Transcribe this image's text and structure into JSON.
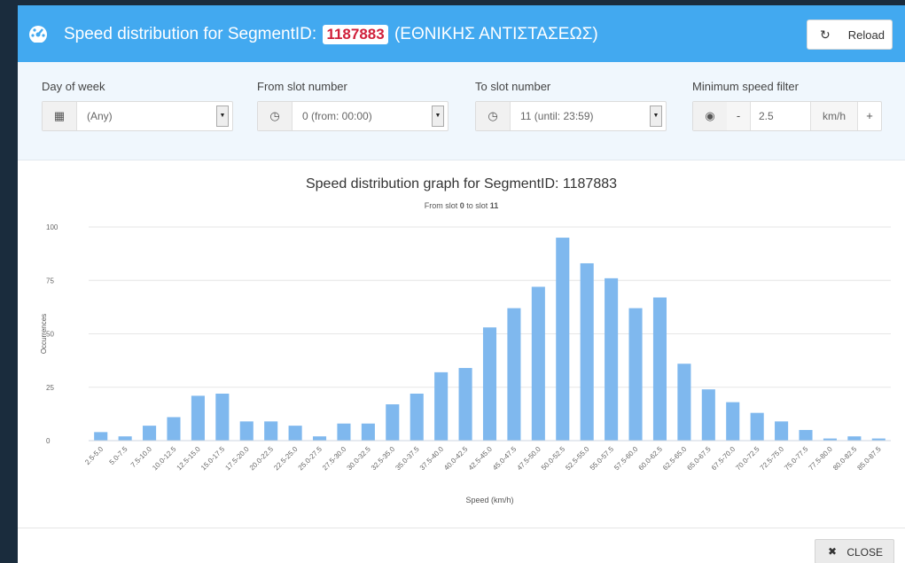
{
  "header": {
    "title_prefix": "Speed distribution for SegmentID:",
    "segment_id": "1187883",
    "street_name": "(ΕΘΝΙΚΗΣ ΑΝΤΙΣΤΑΣΕΩΣ)",
    "reload_label": "Reload",
    "logo_icon": "dashboard-gauge-icon",
    "reload_icon": "refresh-icon"
  },
  "filters": {
    "day_of_week": {
      "label": "Day of week",
      "value": "(Any)",
      "icon": "calendar-icon"
    },
    "from_slot": {
      "label": "From slot number",
      "value": "0 (from: 00:00)",
      "icon": "clock-icon"
    },
    "to_slot": {
      "label": "To slot number",
      "value": "11 (until: 23:59)",
      "icon": "clock-icon"
    },
    "min_speed": {
      "label": "Minimum speed filter",
      "minus": "-",
      "value": "2.5",
      "unit": "km/h",
      "plus": "+",
      "icon": "speedometer-icon"
    }
  },
  "chart": {
    "title": "Speed distribution graph for SegmentID: 1187883",
    "subtitle_prefix": "From slot ",
    "subtitle_from": "0",
    "subtitle_mid": " to slot ",
    "subtitle_to": "11"
  },
  "chart_data": {
    "type": "bar",
    "xlabel": "Speed (km/h)",
    "ylabel": "Occurrences",
    "ylim": [
      0,
      100
    ],
    "yticks": [
      0,
      25,
      50,
      75,
      100
    ],
    "grid": true,
    "legend": "none",
    "bar_color": "#7fb8ee",
    "categories": [
      "2.5-5.0",
      "5.0-7.5",
      "7.5-10.0",
      "10.0-12.5",
      "12.5-15.0",
      "15.0-17.5",
      "17.5-20.0",
      "20.0-22.5",
      "22.5-25.0",
      "25.0-27.5",
      "27.5-30.0",
      "30.0-32.5",
      "32.5-35.0",
      "35.0-37.5",
      "37.5-40.0",
      "40.0-42.5",
      "42.5-45.0",
      "45.0-47.5",
      "47.5-50.0",
      "50.0-52.5",
      "52.5-55.0",
      "55.0-57.5",
      "57.5-60.0",
      "60.0-62.5",
      "62.5-65.0",
      "65.0-67.5",
      "67.5-70.0",
      "70.0-72.5",
      "72.5-75.0",
      "75.0-77.5",
      "77.5-80.0",
      "80.0-82.5",
      "85.0-87.5"
    ],
    "values": [
      4,
      2,
      7,
      11,
      21,
      22,
      9,
      9,
      7,
      2,
      8,
      8,
      17,
      22,
      32,
      34,
      53,
      62,
      72,
      95,
      83,
      76,
      62,
      67,
      36,
      24,
      18,
      13,
      9,
      5,
      1,
      2,
      1
    ]
  },
  "footer": {
    "close_label": "CLOSE",
    "close_icon": "close-icon"
  },
  "colors": {
    "header": "#42a9f0",
    "accent_red": "#d0203b"
  }
}
